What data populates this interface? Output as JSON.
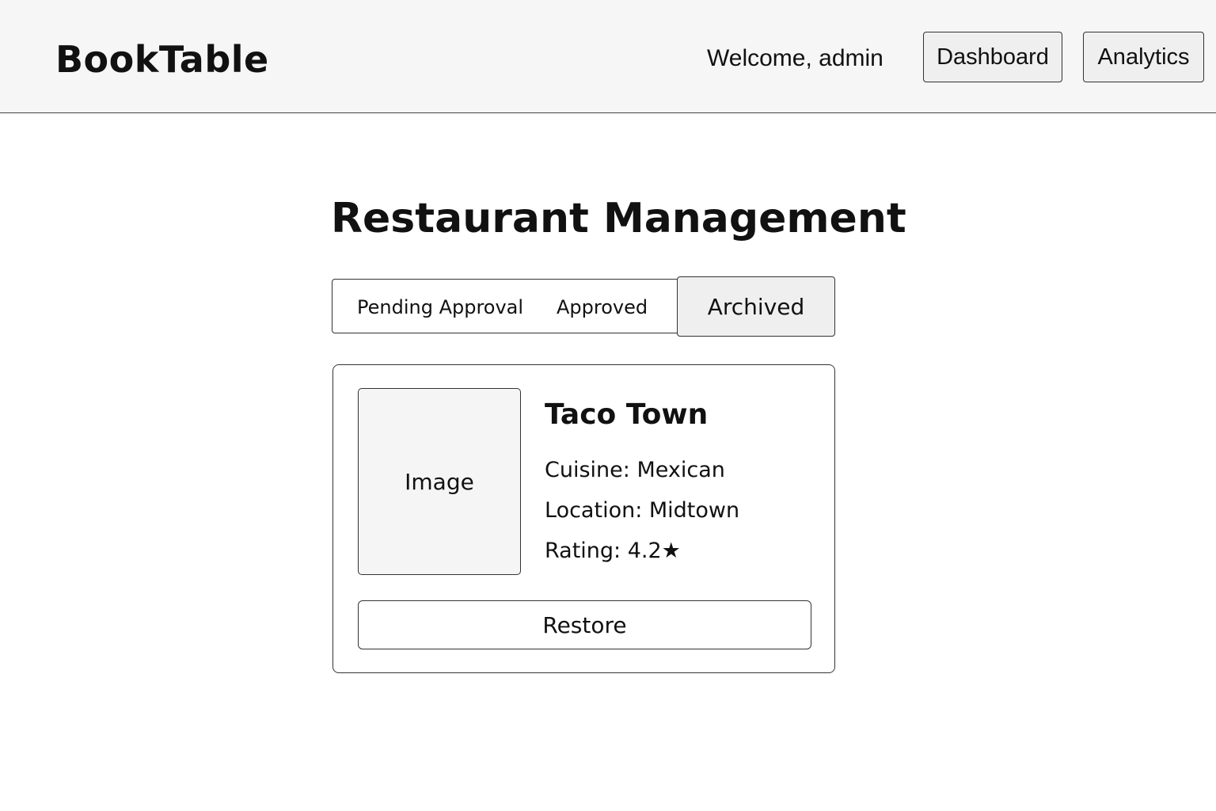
{
  "header": {
    "brand": "BookTable",
    "welcome": "Welcome, admin",
    "nav": {
      "dashboard": "Dashboard",
      "analytics": "Analytics"
    }
  },
  "main": {
    "title": "Restaurant Management",
    "tabs": {
      "pending": "Pending Approval",
      "approved": "Approved",
      "archived": "Archived",
      "active": "Archived"
    },
    "restaurant": {
      "image_label": "Image",
      "name": "Taco Town",
      "cuisine": "Cuisine: Mexican",
      "location": "Location: Midtown",
      "rating": "Rating: 4.2★",
      "action": "Restore"
    }
  }
}
